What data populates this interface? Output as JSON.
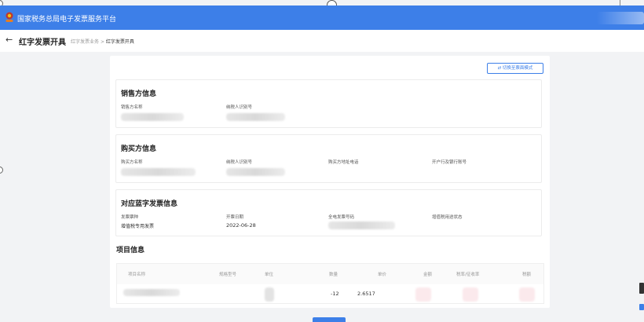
{
  "app": {
    "platform_name": "国家税务总局电子发票服务平台"
  },
  "header": {
    "back_icon": "←",
    "page_title": "红字发票开具",
    "breadcrumb": {
      "parent": "红字发票业务",
      "separator": ">",
      "current": "红字发票开具"
    }
  },
  "switch_button": {
    "icon": "⇄",
    "label": "切换至票面模式"
  },
  "seller": {
    "title": "销售方信息",
    "fields": {
      "name_label": "销售方名称",
      "taxid_label": "纳税人识别号"
    }
  },
  "buyer": {
    "title": "购买方信息",
    "fields": {
      "name_label": "购买方名称",
      "taxid_label": "纳税人识别号",
      "address_label": "购买方地址电话",
      "bank_label": "开户行及银行账号"
    }
  },
  "blue_invoice": {
    "title": "对应蓝字发票信息",
    "invoice_type_label": "发票票种",
    "invoice_type_value": "增值税专用发票",
    "issue_date_label": "开票日期",
    "issue_date_value": "2022-06-28",
    "invoice_no_label": "全电发票号码",
    "vat_status_label": "增值税用途状态"
  },
  "items": {
    "title": "项目信息",
    "columns": [
      "项目名称",
      "规格型号",
      "单位",
      "数量",
      "单价",
      "金额",
      "税率/征收率",
      "税额"
    ],
    "row": {
      "quantity": "-12",
      "unit_price": "2.6517"
    }
  },
  "colors": {
    "primary": "#3d7fe8",
    "page_bg": "#f2f3f5",
    "panel_bg": "#ffffff"
  }
}
